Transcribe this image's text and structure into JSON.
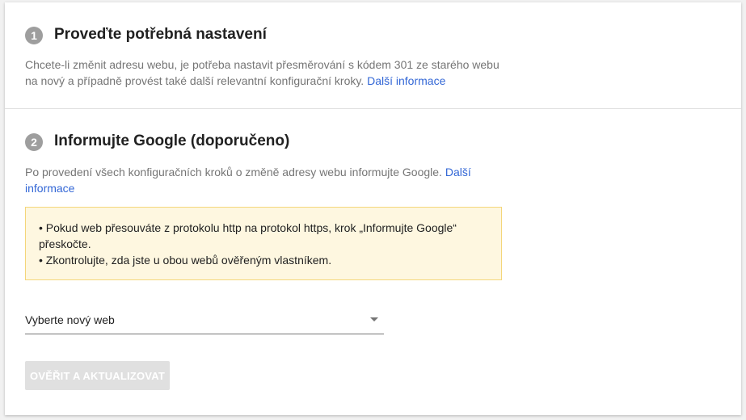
{
  "step1": {
    "number": "1",
    "title": "Proveďte potřebná nastavení",
    "description": "Chcete-li změnit adresu webu, je potřeba nastavit přesměrování s kódem 301 ze starého webu na nový a případně provést také další relevantní konfigurační kroky.",
    "link": "Další informace"
  },
  "step2": {
    "number": "2",
    "title": "Informujte Google (doporučeno)",
    "description": "Po provedení všech konfiguračních kroků o změně adresy webu informujte Google.",
    "link": "Další informace",
    "notice": [
      "• Pokud web přesouváte z protokolu http na protokol https, krok „Informujte Google“ přeskočte.",
      "• Zkontrolujte, zda jste u obou webů ověřeným vlastníkem."
    ],
    "select_label": "Vyberte nový web",
    "button_label": "OVĚŘIT A AKTUALIZOVAT"
  },
  "colors": {
    "link": "#3367d6",
    "notice_background": "#fef7e0",
    "notice_border": "#f4d67a",
    "step_circle": "#9e9e9e",
    "button_disabled": "#e0e0e0"
  },
  "icons": {
    "select_caret": "caret-down-icon"
  }
}
